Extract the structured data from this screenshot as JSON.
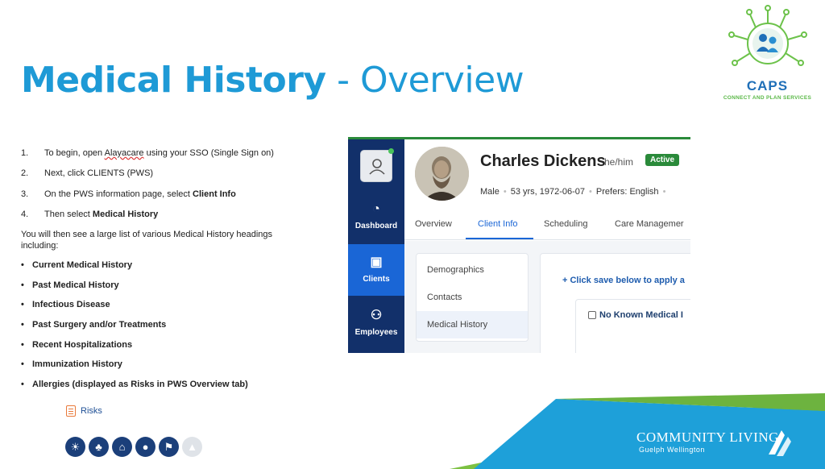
{
  "title": {
    "bold": "Medical History",
    "rest": " - Overview"
  },
  "logo": {
    "name": "CAPS",
    "tagline": "CONNECT AND PLAN SERVICES"
  },
  "steps": [
    {
      "num": "1.",
      "pre": "To begin, open ",
      "link": "Alayacare",
      "post": " using your SSO (Single Sign on)"
    },
    {
      "num": "2.",
      "pre": "Next, click CLIENTS (PWS)"
    },
    {
      "num": "3.",
      "pre": "On the PWS information page, select ",
      "strong": "Client Info"
    },
    {
      "num": "4.",
      "pre": "Then select ",
      "strong": "Medical History"
    }
  ],
  "intro": "You will then see a large list of various Medical History headings including:",
  "bullets": [
    "Current Medical History",
    "Past Medical History",
    "Infectious Disease",
    "Past Surgery and/or Treatments",
    "Recent Hospitalizations",
    "Immunization History",
    "Allergies (displayed as Risks in PWS Overview tab)"
  ],
  "bullet_char": "•",
  "risks_label": "Risks",
  "round_icons": [
    "sun-icon",
    "wheat-icon",
    "home-icon",
    "dog-icon",
    "flag-icon",
    "allergy-icon"
  ],
  "screenshot": {
    "nav": [
      {
        "label": "Dashboard",
        "icon": "dashboard-icon"
      },
      {
        "label": "Clients",
        "icon": "clients-icon"
      },
      {
        "label": "Employees",
        "icon": "employees-icon"
      }
    ],
    "client_name": "Charles Dickens",
    "pronoun": "he/him",
    "status": "Active",
    "meta": [
      "Male",
      "53 yrs, 1972-06-07",
      "Prefers: English"
    ],
    "meta_sep": "•",
    "tabs": [
      "Overview",
      "Client Info",
      "Scheduling",
      "Care Managemer"
    ],
    "submenu": [
      "Demographics",
      "Contacts",
      "Medical History"
    ],
    "save_hint": "+ Click save below to apply a",
    "nkm_label": "No Known Medical I"
  },
  "footer": {
    "org": "COMMUNITY LIVING",
    "sub": "Guelph Wellington"
  },
  "colors": {
    "title_blue": "#1e9ad6",
    "nav_navy": "#12306a",
    "active_blue": "#1a66d6",
    "active_green": "#2a8a3a",
    "footer_green": "#7cc142",
    "footer_blue": "#1ea0d9"
  }
}
